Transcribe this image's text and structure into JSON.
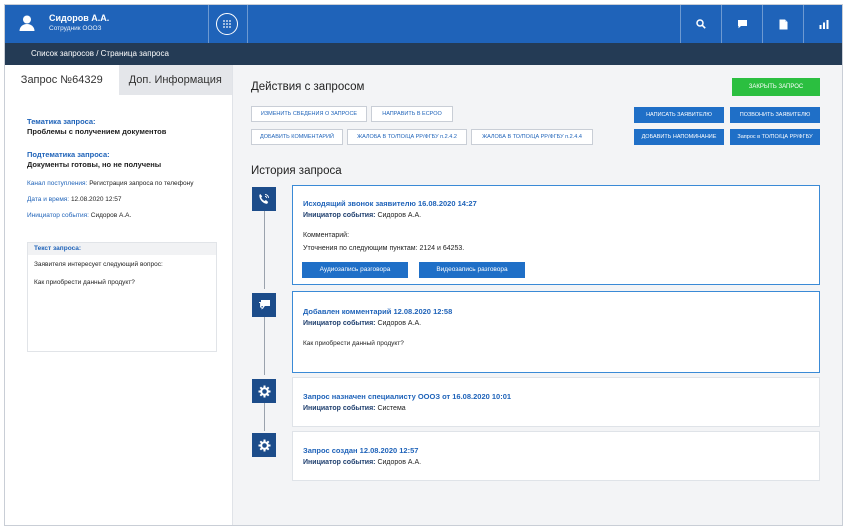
{
  "header": {
    "user_name": "Сидоров А.А.",
    "user_role": "Сотрудник ОООЗ",
    "icons": [
      "dialpad-icon",
      "search-icon",
      "chat-icon",
      "document-icon",
      "stats-icon"
    ]
  },
  "breadcrumb": "Список запросов / Страница запроса",
  "left": {
    "tab_request": "Запрос №64329",
    "tab_info": "Доп. Информация",
    "topic_label": "Тематика запроса:",
    "topic_value": "Проблемы с получением документов",
    "subtopic_label": "Подтематика запроса:",
    "subtopic_value": "Документы готовы, но не получены",
    "channel_label": "Канал поступления:",
    "channel_value": "Регистрация запроса по телефону",
    "datetime_label": "Дата и время:",
    "datetime_value": "12.08.2020 12:57",
    "initiator_label": "Инициатор события:",
    "initiator_value": "Сидоров А.А.",
    "request_text_label": "Текст запроса:",
    "request_text_line1": "Заявителя интересует следующий вопрос:",
    "request_text_line2": "Как приобрести данный продукт?"
  },
  "actions": {
    "title": "Действия с запросом",
    "close": "ЗАКРЫТЬ ЗАПРОС",
    "change_info": "ИЗМЕНИТЬ СВЕДЕНИЯ О ЗАПРОСЕ",
    "send_escoo": "НАПРАВИТЬ В ЕСРОО",
    "add_comment": "ДОБАВИТЬ КОММЕНТАРИЙ",
    "complaint_1": "ЖАЛОБА В ТО/ПО/ЦА РР/ФГБУ п.2.4.2",
    "complaint_2": "ЖАЛОБА В ТО/ПО/ЦА РР/ФГБУ п.2.4.4",
    "write_applicant": "НАПИСАТЬ ЗАЯВИТЕЛЮ",
    "call_applicant": "ПОЗВОНИТЬ ЗАЯВИТЕЛЮ",
    "add_reminder": "ДОБАВИТЬ НАПОМИНАНИЕ",
    "request_to": "Запрос в ТО/ПО/ЦА РР/ФГБУ"
  },
  "history": {
    "title": "История запроса",
    "items": [
      {
        "title": "Исходящий звонок заявителю 16.08.2020 14:27",
        "initiator_label": "Инициатор события:",
        "initiator": "Сидоров А.А.",
        "comment_label": "Комментарий:",
        "comment": "Уточнения по следующим пунктам: 2124 и 64253.",
        "btn_audio": "Аудиозапись разговора",
        "btn_video": "Видеозапись разговора",
        "icon": "phone-icon"
      },
      {
        "title": "Добавлен комментарий 12.08.2020 12:58",
        "initiator_label": "Инициатор события:",
        "initiator": "Сидоров А.А.",
        "text": "Как приобрести данный продукт?",
        "icon": "comment-icon"
      },
      {
        "title": "Запрос назначен специалисту ОООЗ от 16.08.2020 10:01",
        "initiator_label": "Инициатор события:",
        "initiator": "Система",
        "icon": "gear-icon"
      },
      {
        "title": "Запрос создан 12.08.2020 12:57",
        "initiator_label": "Инициатор события:",
        "initiator": "Сидоров А.А.",
        "icon": "gear-icon"
      }
    ]
  },
  "colors": {
    "primary": "#1f63b9",
    "dark_nav": "#243b55",
    "accent_green": "#2bbf40",
    "timeline_icon_bg": "#1c4c8a"
  }
}
